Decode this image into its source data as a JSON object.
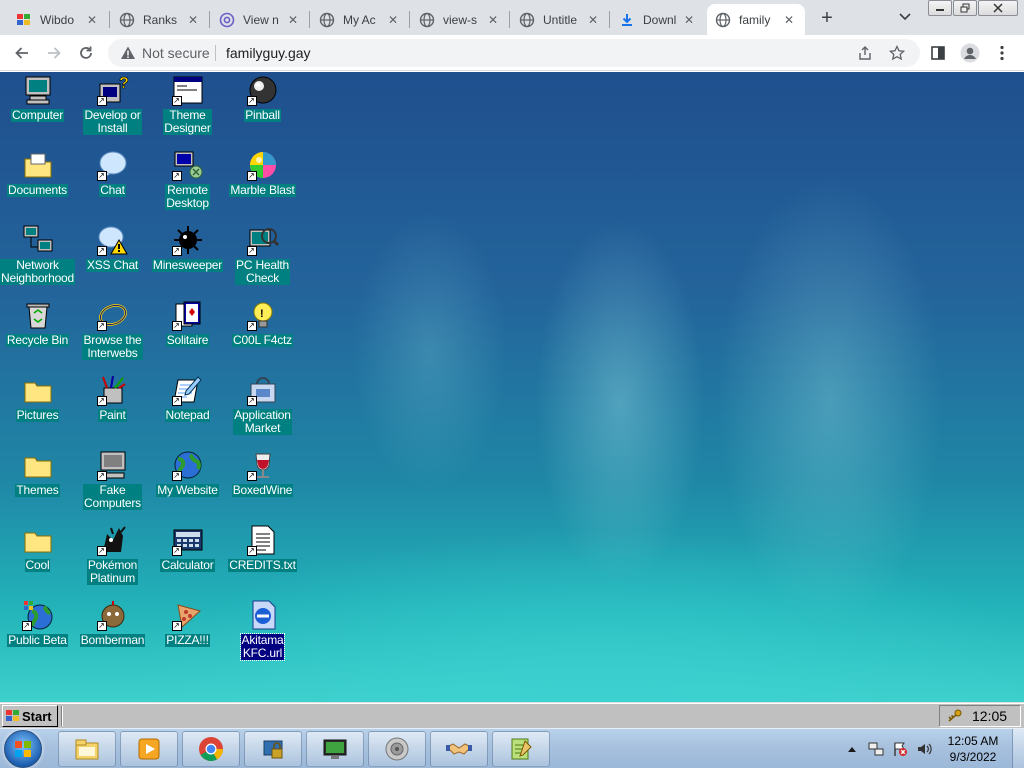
{
  "browser": {
    "tabs": [
      {
        "title": "Wibdo",
        "favicon": "wibdows-icon"
      },
      {
        "title": "Ranks",
        "favicon": "globe-icon"
      },
      {
        "title": "View n",
        "favicon": "at-sign-icon"
      },
      {
        "title": "My Ac",
        "favicon": "globe-icon"
      },
      {
        "title": "view-s",
        "favicon": "globe-icon"
      },
      {
        "title": "Untitle",
        "favicon": "globe-icon"
      },
      {
        "title": "Downl",
        "favicon": "download-icon"
      },
      {
        "title": "family",
        "favicon": "globe-icon",
        "active": true
      }
    ],
    "security_label": "Not secure",
    "url": "familyguy.gay"
  },
  "desktop": {
    "icons": [
      {
        "label": "Computer",
        "icon": "computer-icon"
      },
      {
        "label": "Develop or\nInstall",
        "icon": "develop-install-icon"
      },
      {
        "label": "Theme\nDesigner",
        "icon": "theme-designer-icon"
      },
      {
        "label": "Pinball",
        "icon": "pinball-icon"
      },
      {
        "label": "Documents",
        "icon": "documents-folder-icon"
      },
      {
        "label": "Chat",
        "icon": "chat-icon"
      },
      {
        "label": "Remote\nDesktop",
        "icon": "remote-desktop-icon"
      },
      {
        "label": "Marble Blast",
        "icon": "marble-blast-icon"
      },
      {
        "label": "Network\nNeighborhood",
        "icon": "network-neighborhood-icon"
      },
      {
        "label": "XSS Chat",
        "icon": "xss-chat-icon"
      },
      {
        "label": "Minesweeper",
        "icon": "minesweeper-icon"
      },
      {
        "label": "PC Health\nCheck",
        "icon": "pc-health-check-icon"
      },
      {
        "label": "Recycle Bin",
        "icon": "recycle-bin-icon"
      },
      {
        "label": "Browse the\nInterwebs",
        "icon": "browse-interwebs-icon"
      },
      {
        "label": "Solitaire",
        "icon": "solitaire-icon"
      },
      {
        "label": "C00L F4ctz",
        "icon": "cool-facts-icon"
      },
      {
        "label": "Pictures",
        "icon": "pictures-folder-icon"
      },
      {
        "label": "Paint",
        "icon": "paint-icon"
      },
      {
        "label": "Notepad",
        "icon": "notepad-icon"
      },
      {
        "label": "Application\nMarket",
        "icon": "application-market-icon"
      },
      {
        "label": "Themes",
        "icon": "themes-folder-icon"
      },
      {
        "label": "Fake\nComputers",
        "icon": "fake-computers-icon"
      },
      {
        "label": "My Website",
        "icon": "my-website-icon"
      },
      {
        "label": "BoxedWine",
        "icon": "boxedwine-icon"
      },
      {
        "label": "Cool",
        "icon": "cool-folder-icon"
      },
      {
        "label": "Pokémon\nPlatinum",
        "icon": "pokemon-platinum-icon"
      },
      {
        "label": "Calculator",
        "icon": "calculator-icon"
      },
      {
        "label": "CREDITS.txt",
        "icon": "text-file-icon"
      },
      {
        "label": "Public Beta",
        "icon": "public-beta-icon"
      },
      {
        "label": "Bomberman",
        "icon": "bomberman-icon"
      },
      {
        "label": "PIZZA!!!",
        "icon": "pizza-icon"
      },
      {
        "label": "Akitama\nKFC.url",
        "icon": "internet-shortcut-icon",
        "selected": true
      }
    ]
  },
  "retro_taskbar": {
    "start_label": "Start",
    "clock": "12:05"
  },
  "windows_taskbar": {
    "pinned": [
      "file-explorer-icon",
      "media-player-icon",
      "chrome-icon",
      "security-lock-icon",
      "monitor-app-icon",
      "speaker-app-icon",
      "handshake-icon",
      "notepad-plus-icon"
    ],
    "time": "12:05 AM",
    "date": "9/3/2022"
  },
  "colors": {
    "label_bg": "#008080",
    "selected_label_bg": "#000080",
    "desktop_top": "#1f4f8e",
    "desktop_bottom": "#3ed0cb"
  }
}
